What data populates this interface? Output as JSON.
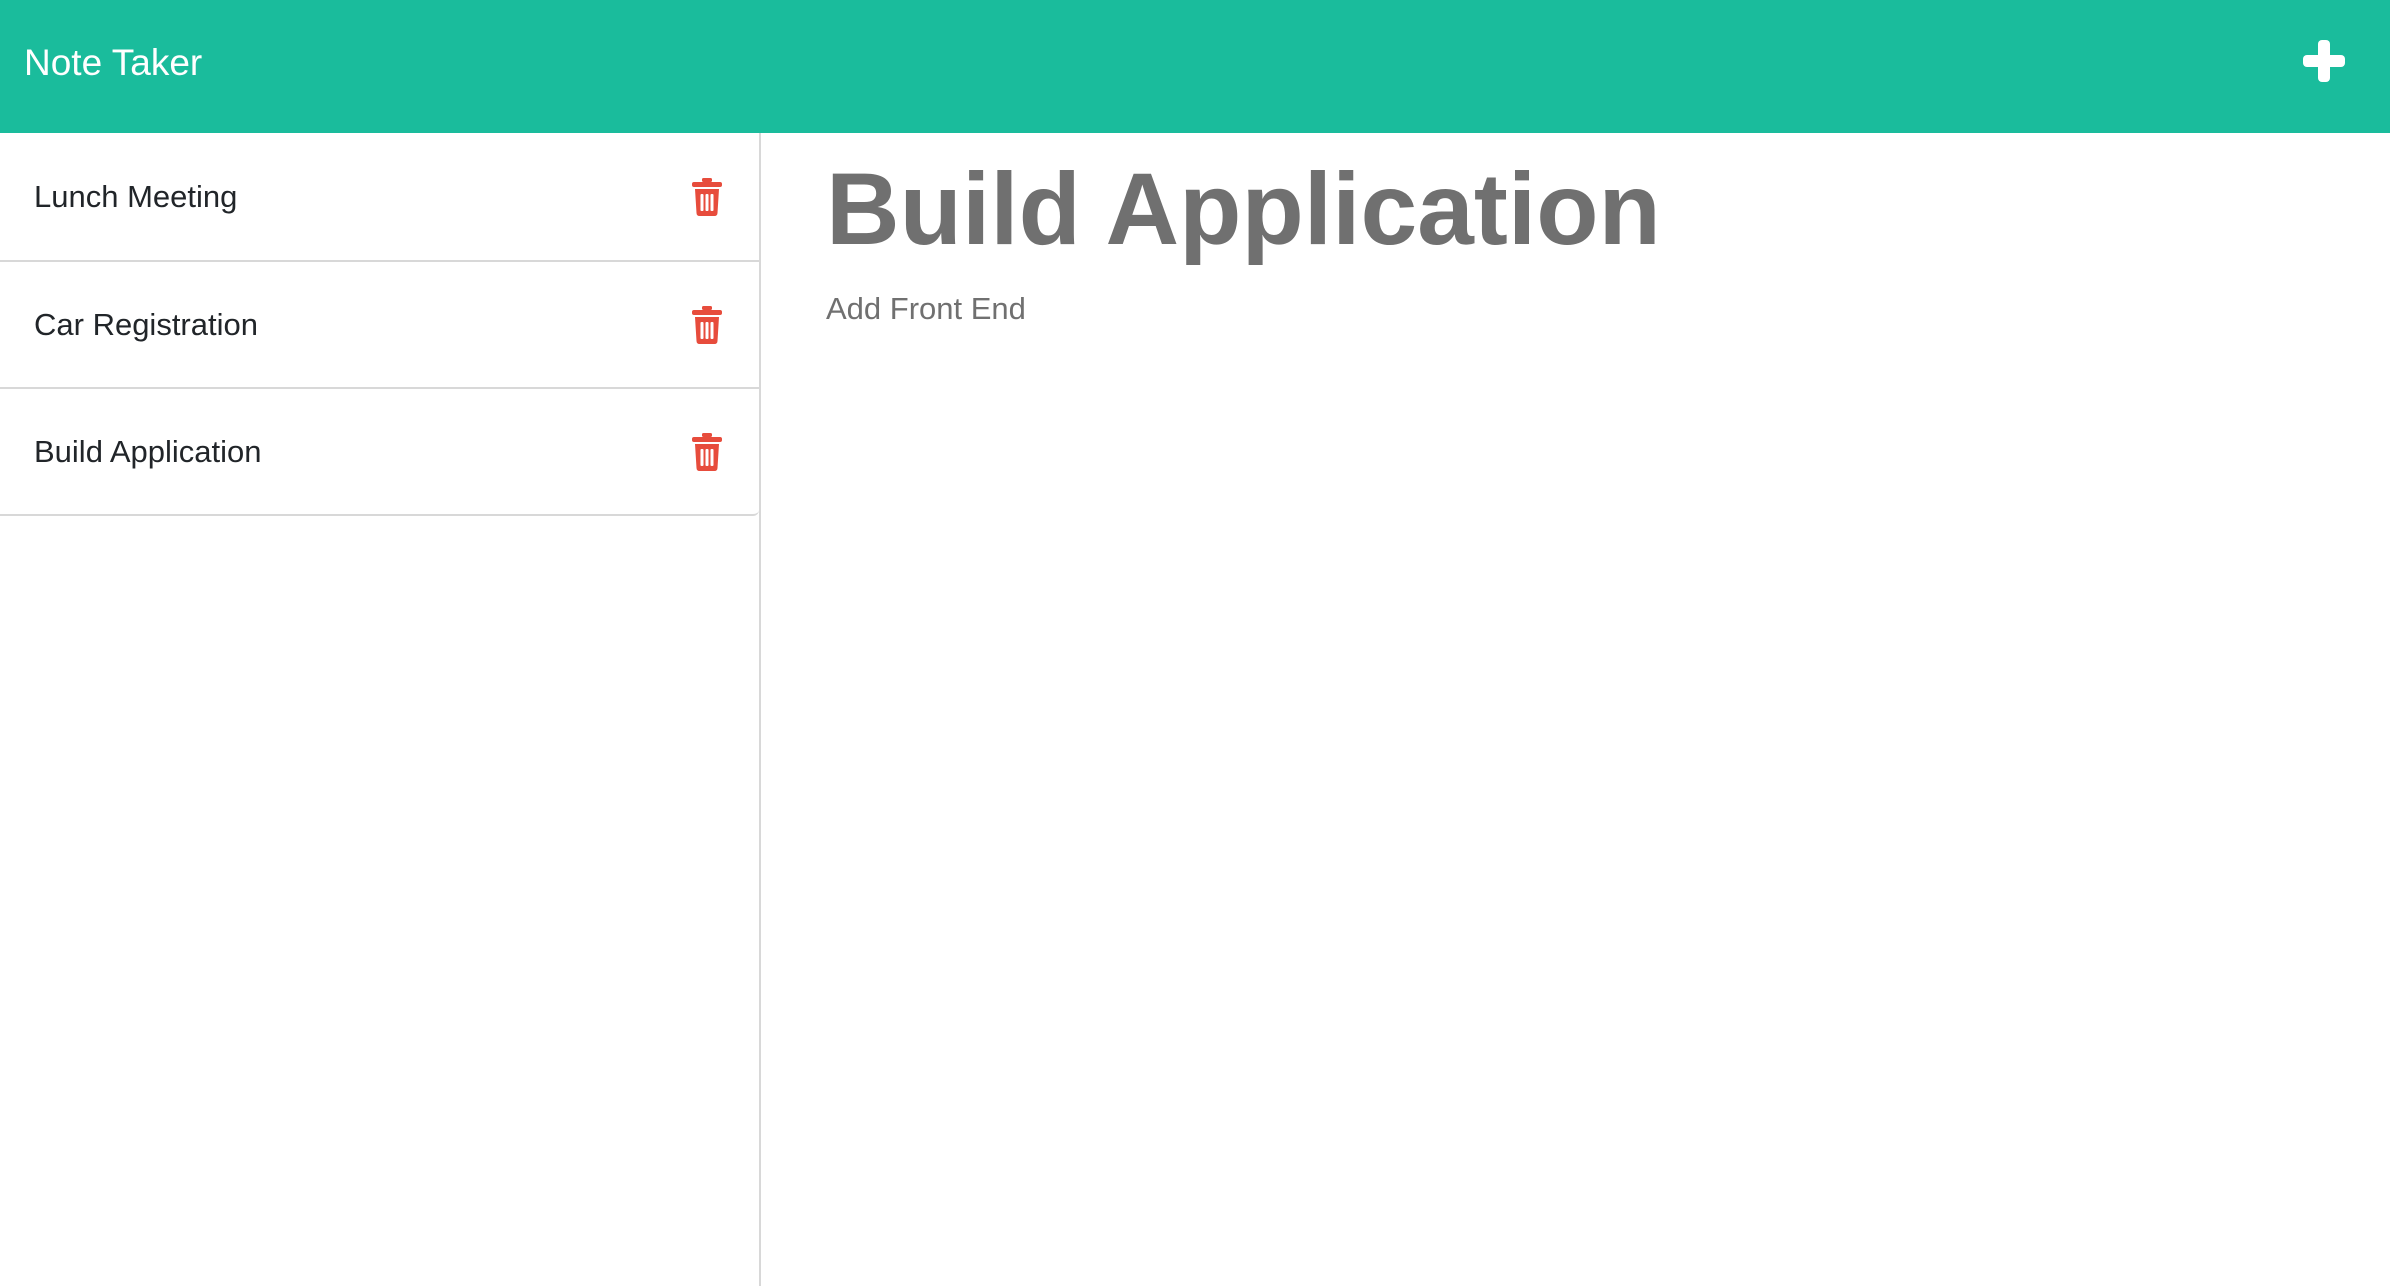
{
  "app": {
    "title": "Note Taker",
    "accent_color": "#1abc9c",
    "delete_color": "#e74c3c",
    "new_note_icon": "plus-icon",
    "delete_icon": "trash-icon"
  },
  "notes": [
    {
      "title": "Lunch Meeting"
    },
    {
      "title": "Car Registration"
    },
    {
      "title": "Build Application"
    }
  ],
  "active_note": {
    "title": "Build Application",
    "text": "Add Front End"
  }
}
